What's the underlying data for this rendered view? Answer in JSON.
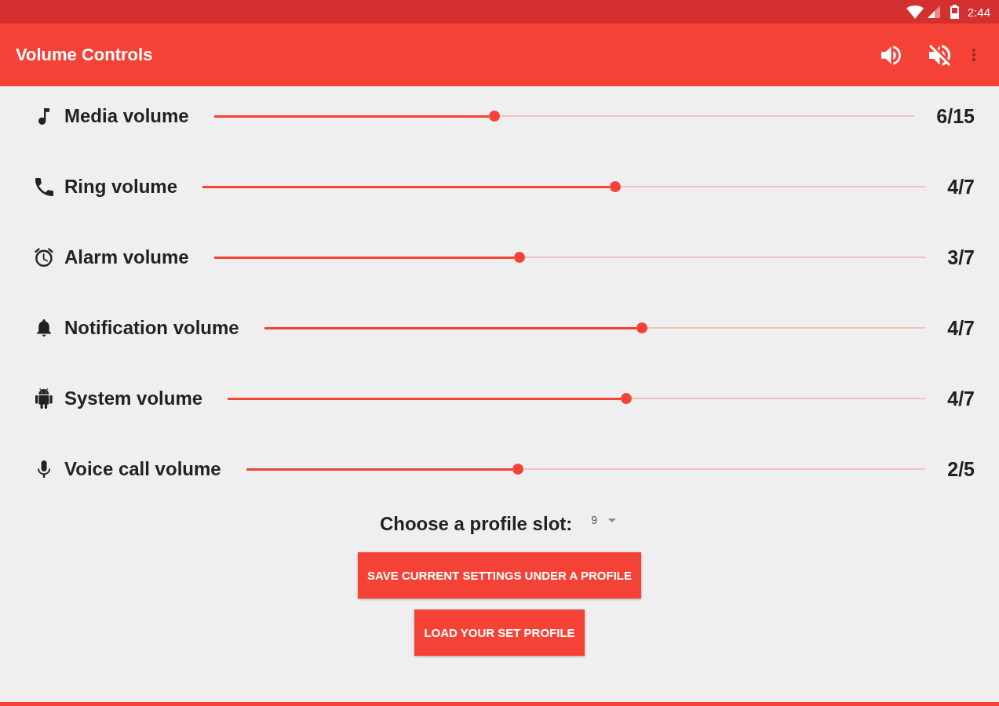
{
  "status_bar": {
    "time": "2:44"
  },
  "app_bar": {
    "title": "Volume Controls"
  },
  "channels": [
    {
      "kind": "media",
      "name": "Media volume",
      "level": 0.4,
      "reading": "6/15"
    },
    {
      "kind": "ring",
      "name": "Ring volume",
      "level": 0.571,
      "reading": "4/7"
    },
    {
      "kind": "alarm",
      "name": "Alarm volume",
      "level": 0.429,
      "reading": "3/7"
    },
    {
      "kind": "notification",
      "name": "Notification volume",
      "level": 0.571,
      "reading": "4/7"
    },
    {
      "kind": "system",
      "name": "System volume",
      "level": 0.571,
      "reading": "4/7"
    },
    {
      "kind": "voice_call",
      "name": "Voice call volume",
      "level": 0.4,
      "reading": "2/5"
    }
  ],
  "profile": {
    "label": "Choose a profile slot:",
    "value": "9"
  },
  "buttons": [
    "SAVE CURRENT SETTINGS UNDER A PROFILE",
    "LOAD YOUR SET PROFILE"
  ]
}
